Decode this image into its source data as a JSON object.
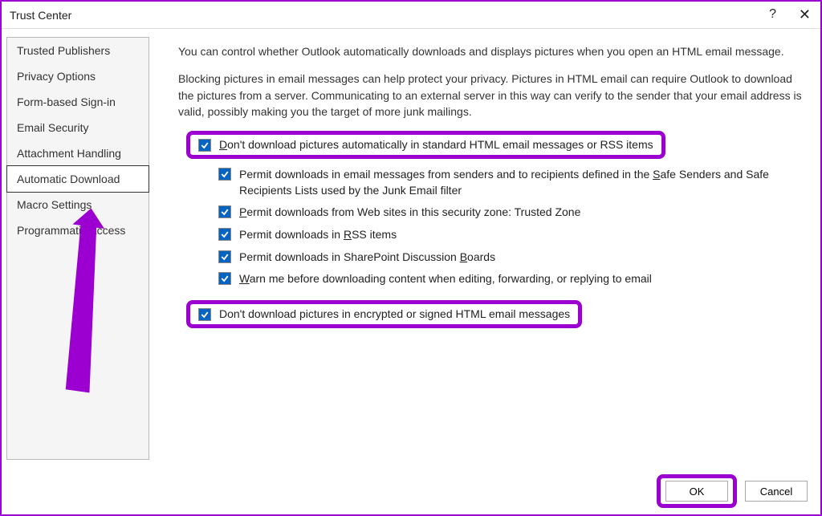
{
  "window": {
    "title": "Trust Center",
    "help": "?",
    "close": "✕"
  },
  "sidebar": {
    "items": [
      {
        "label": "Trusted Publishers"
      },
      {
        "label": "Privacy Options"
      },
      {
        "label": "Form-based Sign-in"
      },
      {
        "label": "Email Security"
      },
      {
        "label": "Attachment Handling"
      },
      {
        "label": "Automatic Download"
      },
      {
        "label": "Macro Settings"
      },
      {
        "label": "Programmatic Access"
      }
    ],
    "selected_index": 5
  },
  "content": {
    "para1": "You can control whether Outlook automatically downloads and displays pictures when you open an HTML email message.",
    "para2": "Blocking pictures in email messages can help protect your privacy. Pictures in HTML email can require Outlook to download the pictures from a server. Communicating to an external server in this way can verify to the sender that your email address is valid, possibly making you the target of more junk mailings.",
    "check_main": "Don't download pictures automatically in standard HTML email messages or RSS items",
    "sub_checks": [
      "Permit downloads in email messages from senders and to recipients defined in the Safe Senders and Safe Recipients Lists used by the Junk Email filter",
      "Permit downloads from Web sites in this security zone: Trusted Zone",
      "Permit downloads in RSS items",
      "Permit downloads in SharePoint Discussion Boards",
      "Warn me before downloading content when editing, forwarding, or replying to email"
    ],
    "check_encrypted": "Don't download pictures in encrypted or signed HTML email messages"
  },
  "footer": {
    "ok": "OK",
    "cancel": "Cancel"
  }
}
